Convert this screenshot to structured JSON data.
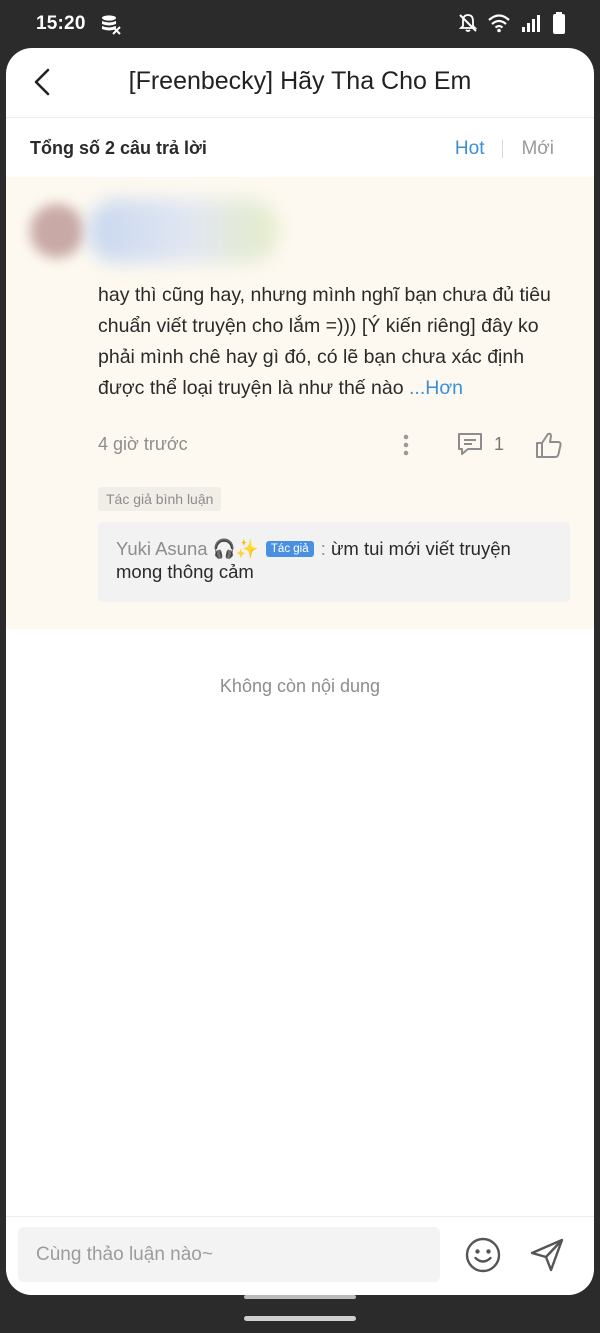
{
  "status_bar": {
    "time": "15:20",
    "icons": [
      "data-saver-icon",
      "bell-off-icon",
      "wifi-icon",
      "signal-icon",
      "battery-icon"
    ]
  },
  "header": {
    "title": "[Freenbecky] Hãy Tha Cho Em",
    "back_icon": "chevron-left-icon"
  },
  "subbar": {
    "total_label": "Tổng số 2 câu trả lời",
    "tab_hot": "Hot",
    "tab_new": "Mới",
    "active_tab": "Hot"
  },
  "comment": {
    "text": "hay thì cũng hay, nhưng mình nghĩ bạn chưa đủ tiêu chuẩn viết truyện cho lắm =))) [Ý kiến riêng] đây ko phải mình chê hay gì đó, có lẽ bạn chưa xác định được thể loại truyện là như thế nào",
    "more_label": "...Hơn",
    "time": "4 giờ trước",
    "reply_count": "1",
    "author_tag": "Tác giả bình luận",
    "reply": {
      "user": "Yuki Asuna 🎧✨",
      "badge": "Tác giả",
      "separator": " : ",
      "text": "ừm tui mới viết truyện mong thông cảm"
    }
  },
  "end_note": "Không còn nội dung",
  "composer": {
    "placeholder": "Cùng thảo luận nào~"
  },
  "colors": {
    "accent": "#3a8fd6",
    "comment_bg": "#fdf9f0",
    "badge": "#4a90e2"
  }
}
